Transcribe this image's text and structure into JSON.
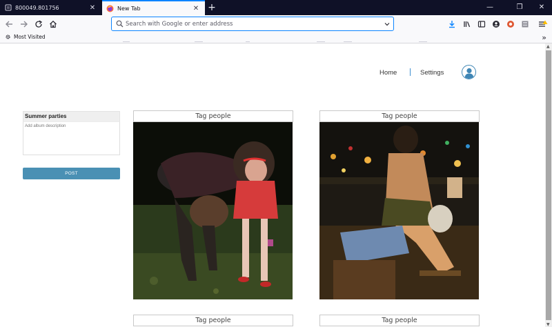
{
  "browser": {
    "tabs": [
      {
        "title": "800049.801756",
        "close": "✕"
      },
      {
        "title": "New Tab",
        "close": "✕"
      }
    ],
    "new_tab": "+",
    "window_controls": {
      "minimize": "—",
      "restore": "❐",
      "close": "✕"
    },
    "urlbar": {
      "placeholder": "Search with Google or enter address",
      "value": ""
    },
    "bookmarks": [
      {
        "label": "Most Visited"
      }
    ],
    "bookmarks_overflow": "»"
  },
  "site": {
    "nav": {
      "home": "Home",
      "settings": "Settings"
    },
    "album": {
      "title": "Summer parties",
      "description_placeholder": "Add album description",
      "description_value": "",
      "post_label": "POST"
    },
    "photos": [
      {
        "tag_label": "Tag people"
      },
      {
        "tag_label": "Tag people"
      },
      {
        "tag_label": "Tag people"
      },
      {
        "tag_label": "Tag people"
      }
    ]
  },
  "colors": {
    "tabbar": "#0f1127",
    "accent": "#0a84ff",
    "post_button": "#4a90b4",
    "nav_divider": "#3d8ed0"
  }
}
